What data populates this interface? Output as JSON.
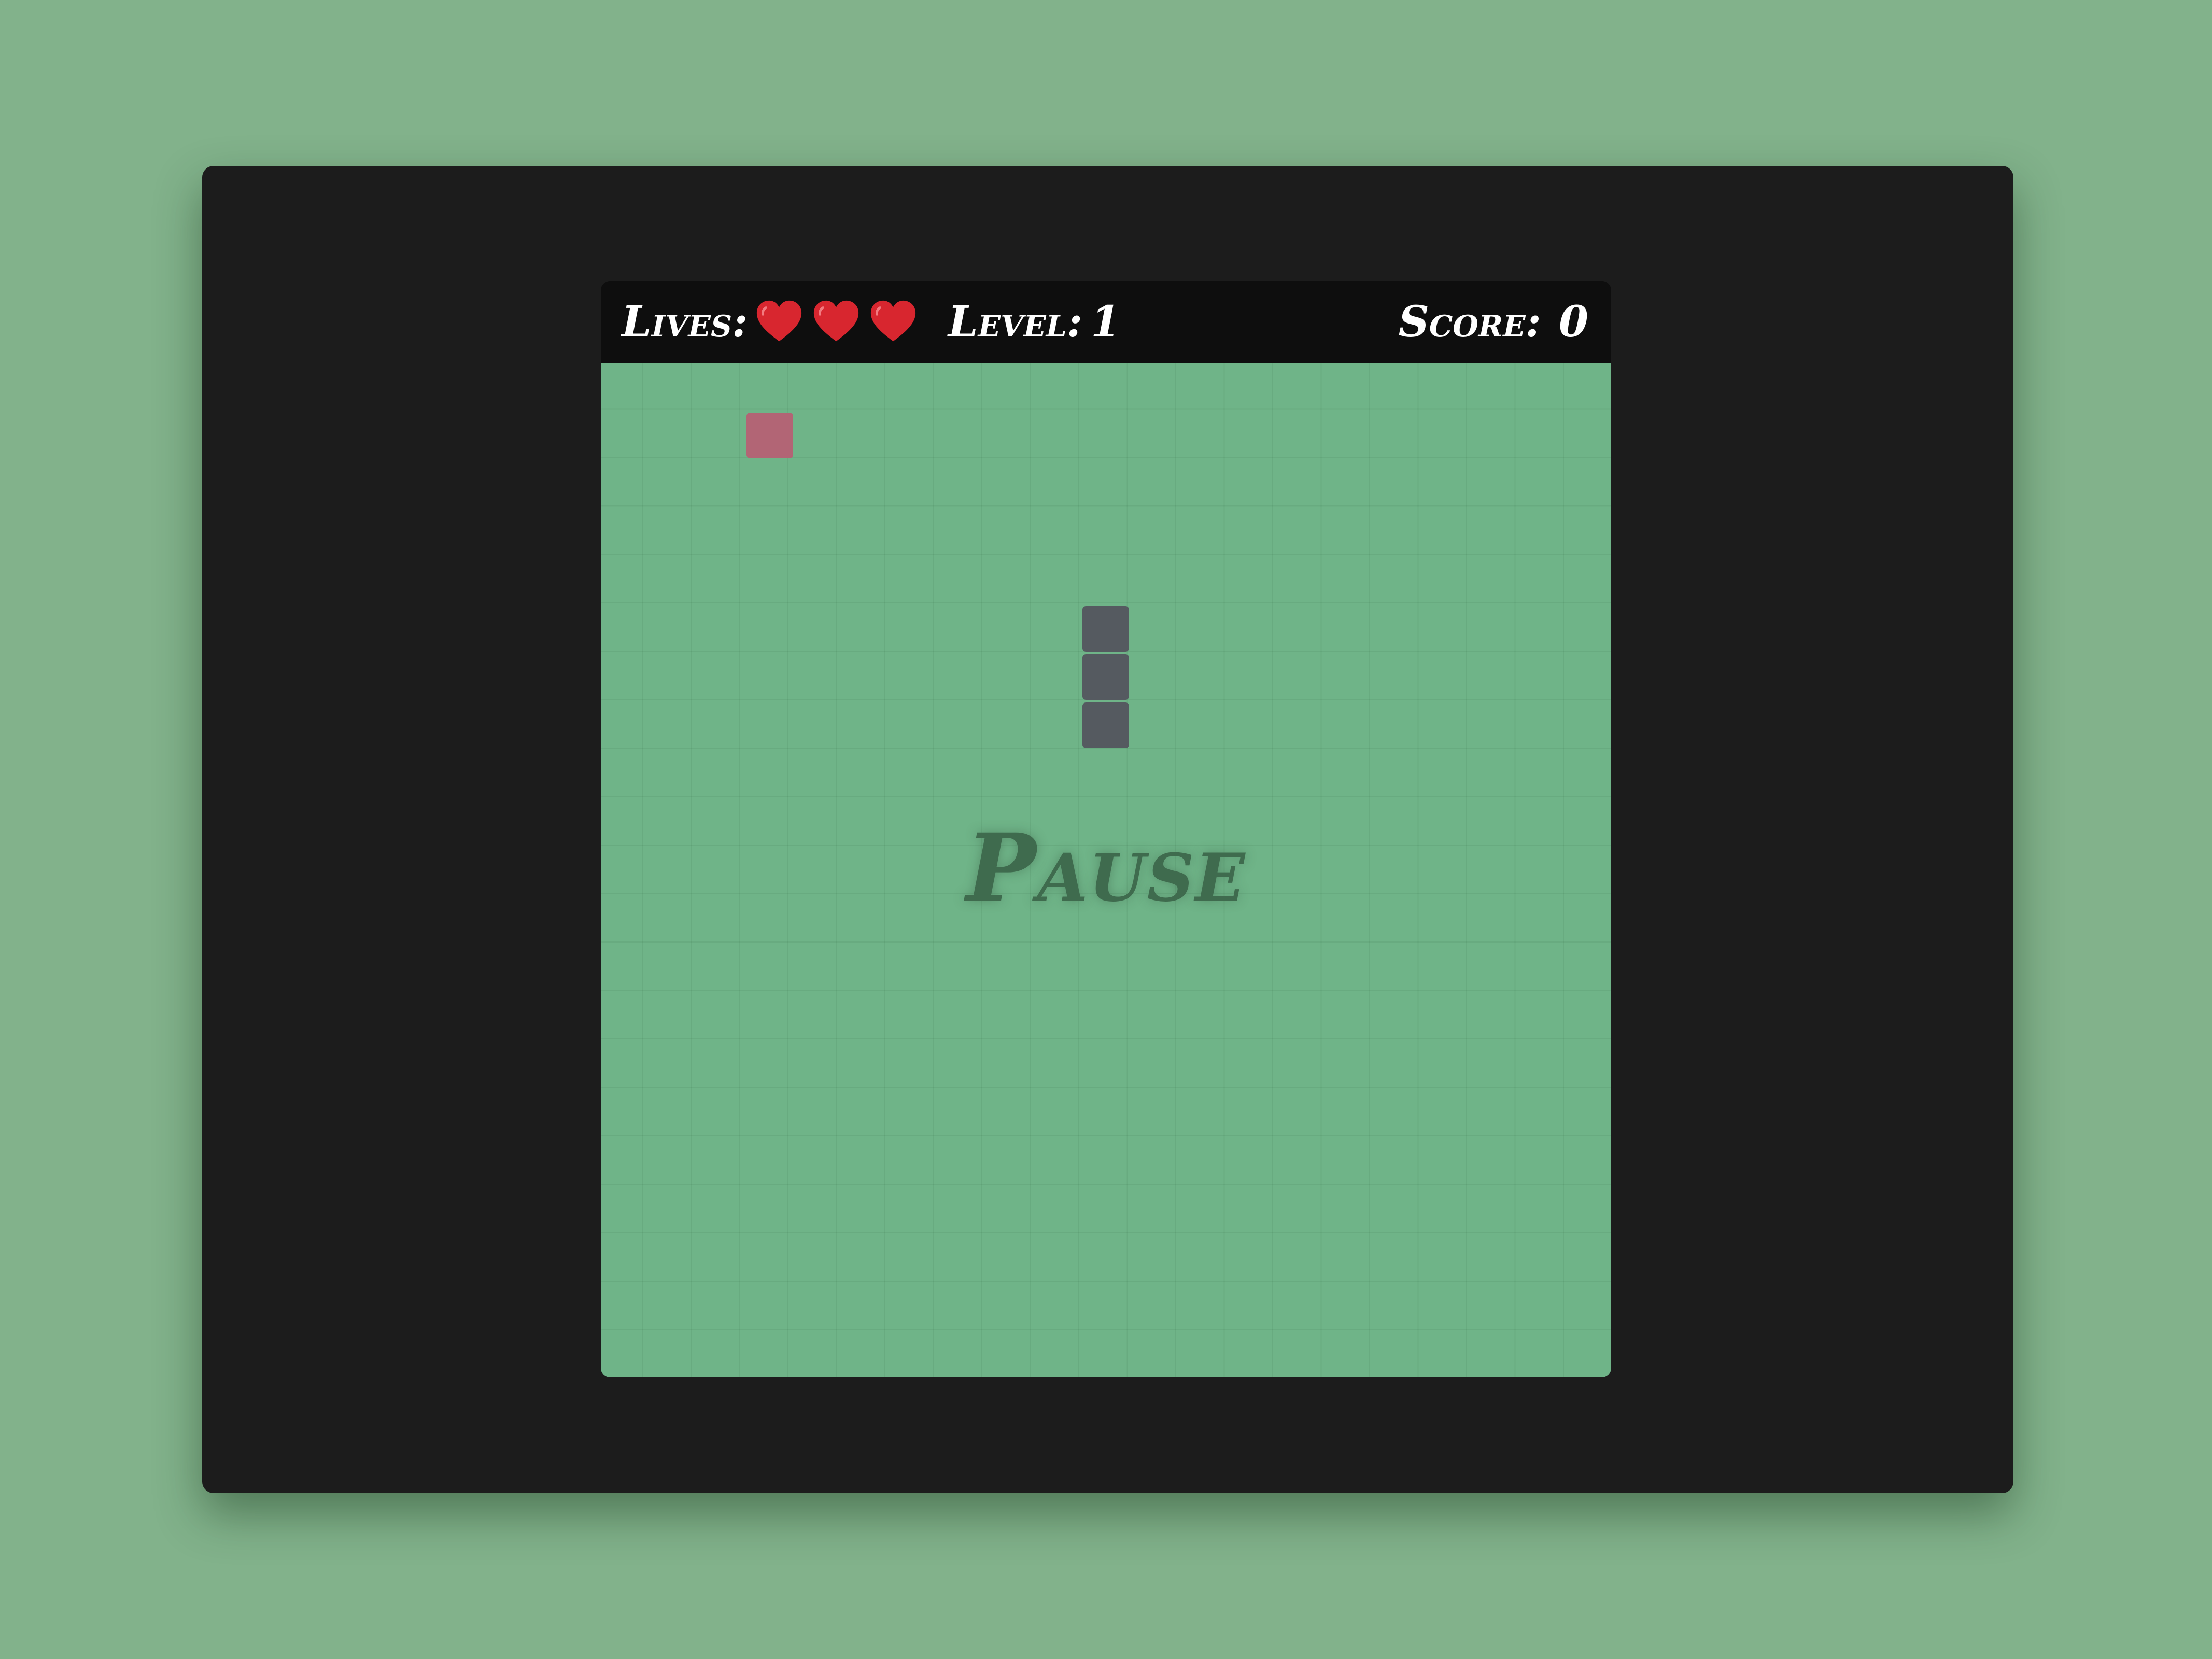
{
  "hud": {
    "lives_label": "Lives:",
    "lives_count": 3,
    "heart_icon": "heart-icon",
    "heart_color": "#d8262f",
    "level_label": "Level:",
    "level_value": "1",
    "score_label": "Score:",
    "score_value": "0"
  },
  "board": {
    "background_color": "#6fb488",
    "food_color": "#b26575",
    "snake_color": "#555a60",
    "snake_length": 3
  },
  "overlay": {
    "pause_text": "Pause"
  },
  "colors": {
    "page_background": "#82b28b",
    "frame_background": "#1c1c1c",
    "hud_background": "#0e0e0e",
    "pause_text_color": "#3f6b4e"
  }
}
